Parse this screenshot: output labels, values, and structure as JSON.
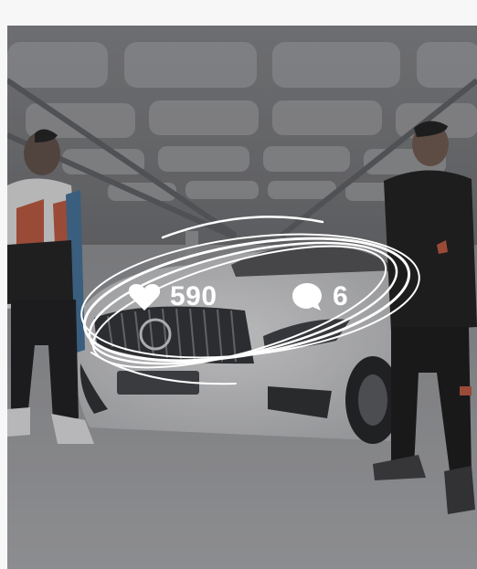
{
  "post": {
    "likes_count": "590",
    "comments_count": "6",
    "icons": {
      "likes": "heart-icon",
      "comments": "speech-bubble-icon"
    },
    "colors": {
      "overlay_text": "#ffffff",
      "scribble": "#ffffff"
    }
  }
}
